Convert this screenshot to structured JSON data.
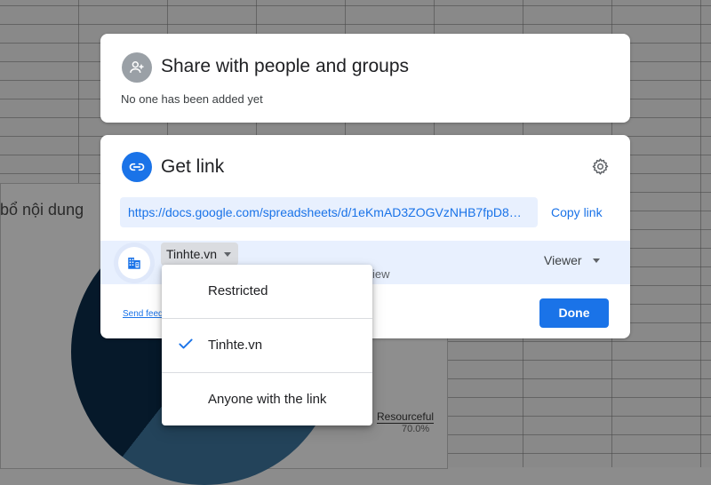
{
  "background": {
    "chart_title_fragment": "bổ nội dung",
    "legend_label": "Resourceful",
    "legend_value": "70.0%"
  },
  "share_card": {
    "icon": "person-add-icon",
    "title": "Share with people and groups",
    "subtitle": "No one has been added yet"
  },
  "link_card": {
    "icon": "link-icon",
    "title": "Get link",
    "settings_icon": "gear-icon",
    "url": "https://docs.google.com/spreadsheets/d/1eKmAD3ZOGVzNHB7fpD8DNe...",
    "copy_link_label": "Copy link",
    "access": {
      "org_icon": "domain-icon",
      "scope_label": "Tinhte.vn",
      "description_fragment": "iew",
      "role_label": "Viewer"
    },
    "send_feedback_label": "Send feed",
    "done_label": "Done"
  },
  "scope_menu": {
    "items": [
      {
        "label": "Restricted",
        "selected": false
      },
      {
        "label": "Tinhte.vn",
        "selected": true
      },
      {
        "label": "Anyone with the link",
        "selected": false
      }
    ]
  },
  "colors": {
    "accent": "#1a73e8",
    "highlight": "#e8f0fe"
  }
}
